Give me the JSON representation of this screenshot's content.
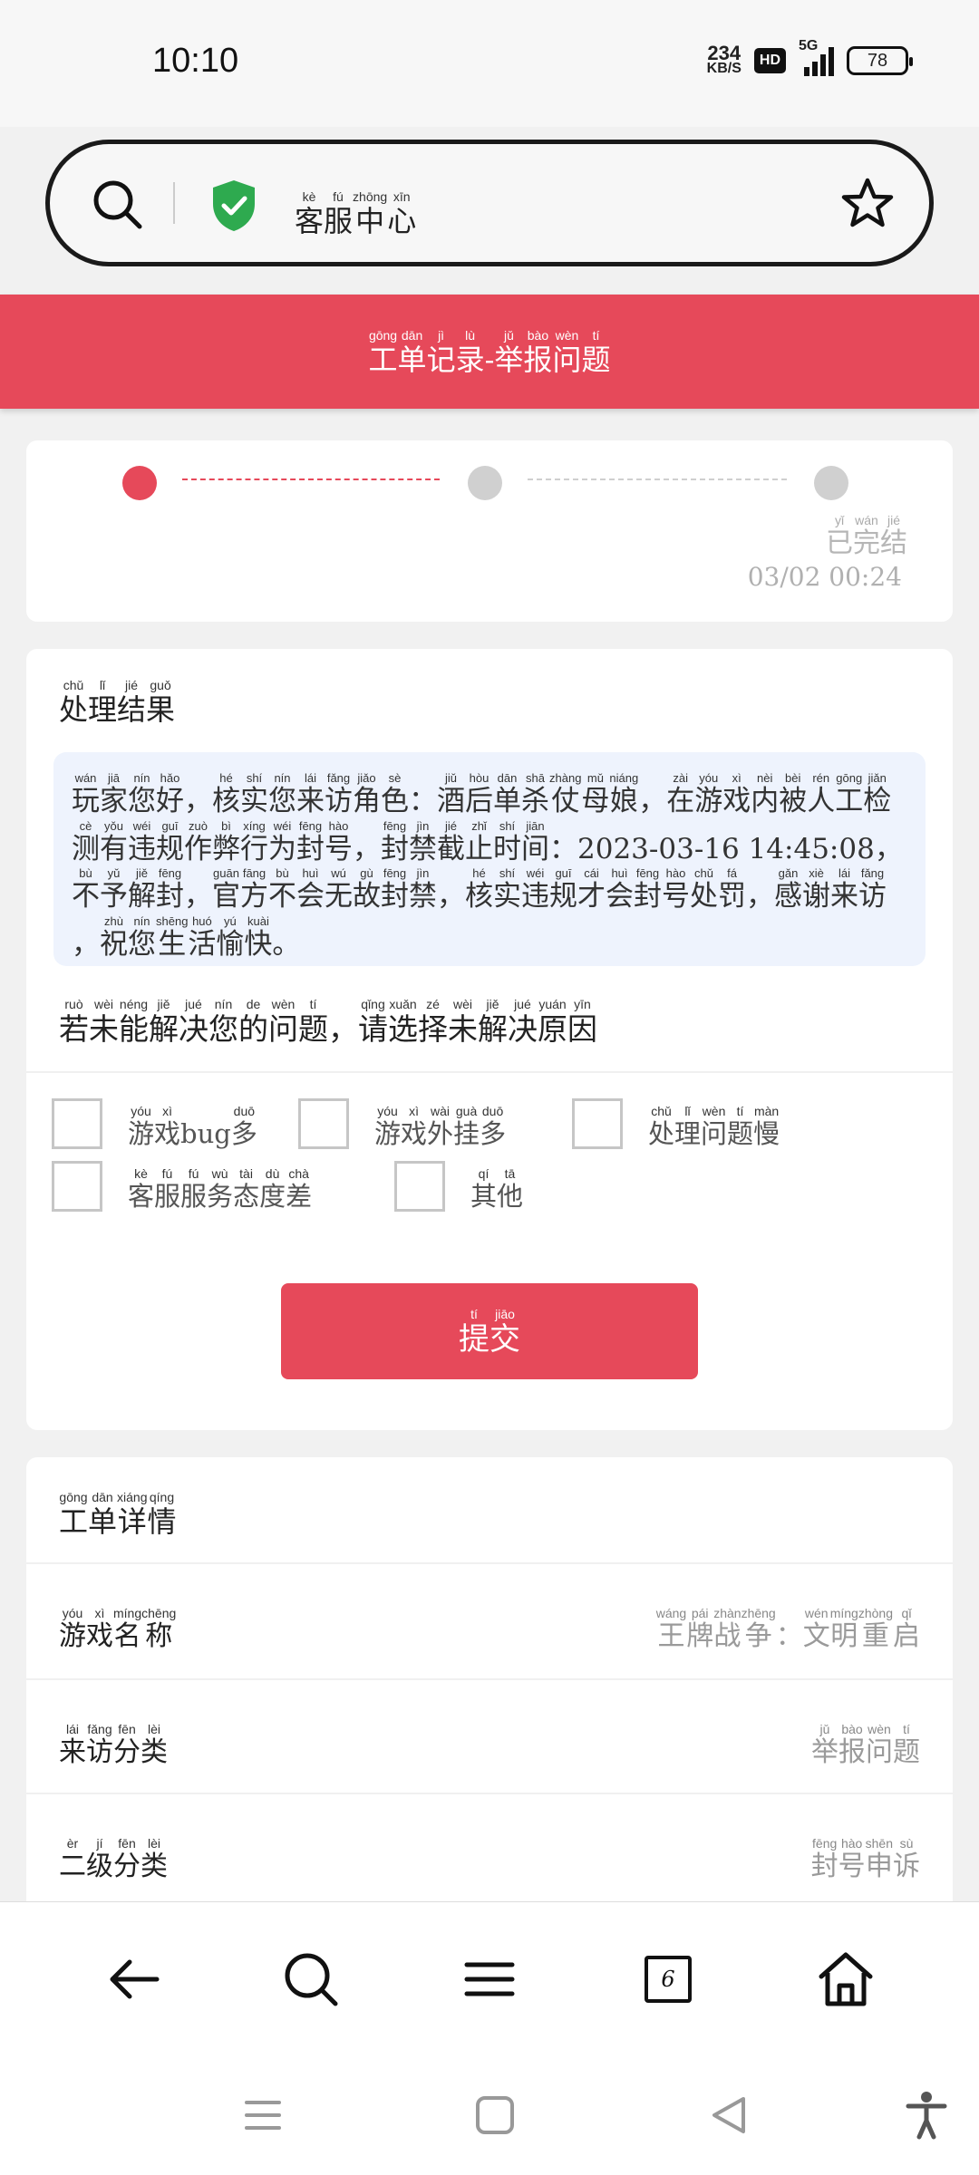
{
  "status_bar": {
    "time": "10:10",
    "net_speed": "234",
    "net_unit": "KB/S",
    "hd": "HD",
    "network": "5G",
    "battery": "78"
  },
  "search_bar": {
    "title": [
      [
        "kè",
        "客"
      ],
      [
        "fú",
        "服"
      ],
      [
        "zhōng",
        "中"
      ],
      [
        "xīn",
        "心"
      ]
    ]
  },
  "header": {
    "title": [
      [
        "gōng",
        "工"
      ],
      [
        "dān",
        "单"
      ],
      [
        "jì",
        "记"
      ],
      [
        "lù",
        "录"
      ],
      [
        "",
        "-"
      ],
      [
        "jǔ",
        "举"
      ],
      [
        "bào",
        "报"
      ],
      [
        "wèn",
        "问"
      ],
      [
        "tí",
        "题"
      ]
    ]
  },
  "progress": {
    "steps_done": 1,
    "steps_total": 3,
    "final_label": [
      [
        "yǐ",
        "已"
      ],
      [
        "wán",
        "完"
      ],
      [
        "jié",
        "结"
      ]
    ],
    "final_date": "03/02 00:24",
    "colors": {
      "active": "#e6495a",
      "inactive": "#d0d0d0"
    }
  },
  "result": {
    "title": [
      [
        "chǔ",
        "处"
      ],
      [
        "lǐ",
        "理"
      ],
      [
        "jié",
        "结"
      ],
      [
        "guǒ",
        "果"
      ]
    ],
    "text": [
      [
        "wán",
        "玩"
      ],
      [
        "jiā",
        "家"
      ],
      [
        "nín",
        "您"
      ],
      [
        "hǎo",
        "好"
      ],
      [
        "",
        "，"
      ],
      [
        "hé",
        "核"
      ],
      [
        "shí",
        "实"
      ],
      [
        "nín",
        "您"
      ],
      [
        "lái",
        "来"
      ],
      [
        "fǎng",
        "访"
      ],
      [
        "jiǎo",
        "角"
      ],
      [
        "sè",
        "色"
      ],
      [
        "",
        "："
      ],
      [
        "jiǔ",
        "酒"
      ],
      [
        "hòu",
        "后"
      ],
      [
        "dān",
        "单"
      ],
      [
        "shā",
        "杀"
      ],
      [
        "zhàng",
        "仗"
      ],
      [
        "mǔ",
        "母"
      ],
      [
        "niáng",
        "娘"
      ],
      [
        "",
        "，"
      ],
      [
        "zài",
        "在"
      ],
      [
        "yóu",
        "游"
      ],
      [
        "xì",
        "戏"
      ],
      [
        "nèi",
        "内"
      ],
      [
        "bèi",
        "被"
      ],
      [
        "rén",
        "人"
      ],
      [
        "gōng",
        "工"
      ],
      [
        "jiǎn",
        "检"
      ],
      [
        "cè",
        "测"
      ],
      [
        "yǒu",
        "有"
      ],
      [
        "wéi",
        "违"
      ],
      [
        "guī",
        "规"
      ],
      [
        "zuò",
        "作"
      ],
      [
        "bì",
        "弊"
      ],
      [
        "xíng",
        "行"
      ],
      [
        "wéi",
        "为"
      ],
      [
        "fēng",
        "封"
      ],
      [
        "hào",
        "号"
      ],
      [
        "",
        "，"
      ],
      [
        "fēng",
        "封"
      ],
      [
        "jìn",
        "禁"
      ],
      [
        "jié",
        "截"
      ],
      [
        "zhǐ",
        "止"
      ],
      [
        "shí",
        "时"
      ],
      [
        "jiān",
        "间"
      ],
      [
        "",
        "："
      ],
      [
        "",
        "2023-03-16 14:45:08"
      ],
      [
        "",
        "，"
      ],
      [
        "bù",
        "不"
      ],
      [
        "yǔ",
        "予"
      ],
      [
        "jiě",
        "解"
      ],
      [
        "fēng",
        "封"
      ],
      [
        "",
        "，"
      ],
      [
        "guān",
        "官"
      ],
      [
        "fāng",
        "方"
      ],
      [
        "bù",
        "不"
      ],
      [
        "huì",
        "会"
      ],
      [
        "wú",
        "无"
      ],
      [
        "gù",
        "故"
      ],
      [
        "fēng",
        "封"
      ],
      [
        "jìn",
        "禁"
      ],
      [
        "",
        "，"
      ],
      [
        "hé",
        "核"
      ],
      [
        "shí",
        "实"
      ],
      [
        "wéi",
        "违"
      ],
      [
        "guī",
        "规"
      ],
      [
        "cái",
        "才"
      ],
      [
        "huì",
        "会"
      ],
      [
        "fēng",
        "封"
      ],
      [
        "hào",
        "号"
      ],
      [
        "chǔ",
        "处"
      ],
      [
        "fá",
        "罚"
      ],
      [
        "",
        "，"
      ],
      [
        "gǎn",
        "感"
      ],
      [
        "xiè",
        "谢"
      ],
      [
        "lái",
        "来"
      ],
      [
        "fǎng",
        "访"
      ],
      [
        "",
        "，"
      ],
      [
        "zhù",
        "祝"
      ],
      [
        "nín",
        "您"
      ],
      [
        "shēng",
        "生"
      ],
      [
        "huó",
        "活"
      ],
      [
        "yú",
        "愉"
      ],
      [
        "kuài",
        "快"
      ],
      [
        "",
        "。"
      ]
    ],
    "question": [
      [
        "ruò",
        "若"
      ],
      [
        "wèi",
        "未"
      ],
      [
        "néng",
        "能"
      ],
      [
        "jiě",
        "解"
      ],
      [
        "jué",
        "决"
      ],
      [
        "nín",
        "您"
      ],
      [
        "de",
        "的"
      ],
      [
        "wèn",
        "问"
      ],
      [
        "tí",
        "题"
      ],
      [
        "",
        "，"
      ],
      [
        "qǐng",
        "请"
      ],
      [
        "xuǎn",
        "选"
      ],
      [
        "zé",
        "择"
      ],
      [
        "wèi",
        "未"
      ],
      [
        "jiě",
        "解"
      ],
      [
        "jué",
        "决"
      ],
      [
        "yuán",
        "原"
      ],
      [
        "yīn",
        "因"
      ]
    ],
    "options": [
      [
        [
          "yóu",
          "游"
        ],
        [
          "xì",
          "戏"
        ],
        [
          "",
          "bug"
        ],
        [
          "duō",
          "多"
        ]
      ],
      [
        [
          "yóu",
          "游"
        ],
        [
          "xì",
          "戏"
        ],
        [
          "wài",
          "外"
        ],
        [
          "guà",
          "挂"
        ],
        [
          "duō",
          "多"
        ]
      ],
      [
        [
          "chǔ",
          "处"
        ],
        [
          "lǐ",
          "理"
        ],
        [
          "wèn",
          "问"
        ],
        [
          "tí",
          "题"
        ],
        [
          "màn",
          "慢"
        ]
      ],
      [
        [
          "kè",
          "客"
        ],
        [
          "fú",
          "服"
        ],
        [
          "fú",
          "服"
        ],
        [
          "wù",
          "务"
        ],
        [
          "tài",
          "态"
        ],
        [
          "dù",
          "度"
        ],
        [
          "chà",
          "差"
        ]
      ],
      [
        [
          "qí",
          "其"
        ],
        [
          "tā",
          "他"
        ]
      ]
    ],
    "submit": [
      [
        "tí",
        "提"
      ],
      [
        "jiāo",
        "交"
      ]
    ]
  },
  "details": {
    "title": [
      [
        "gōng",
        "工"
      ],
      [
        "dān",
        "单"
      ],
      [
        "xiáng",
        "详"
      ],
      [
        "qíng",
        "情"
      ]
    ],
    "rows": [
      {
        "key": [
          [
            "yóu",
            "游"
          ],
          [
            "xì",
            "戏"
          ],
          [
            "míng",
            "名"
          ],
          [
            "chēng",
            "称"
          ]
        ],
        "value": [
          [
            "wáng",
            "王"
          ],
          [
            "pái",
            "牌"
          ],
          [
            "zhàn",
            "战"
          ],
          [
            "zhēng",
            "争"
          ],
          [
            "",
            "："
          ],
          [
            "wén",
            "文"
          ],
          [
            "míng",
            "明"
          ],
          [
            "zhòng",
            "重"
          ],
          [
            "qǐ",
            "启"
          ]
        ]
      },
      {
        "key": [
          [
            "lái",
            "来"
          ],
          [
            "fǎng",
            "访"
          ],
          [
            "fēn",
            "分"
          ],
          [
            "lèi",
            "类"
          ]
        ],
        "value": [
          [
            "jǔ",
            "举"
          ],
          [
            "bào",
            "报"
          ],
          [
            "wèn",
            "问"
          ],
          [
            "tí",
            "题"
          ]
        ]
      },
      {
        "key": [
          [
            "èr",
            "二"
          ],
          [
            "jí",
            "级"
          ],
          [
            "fēn",
            "分"
          ],
          [
            "lèi",
            "类"
          ]
        ],
        "value": [
          [
            "fēng",
            "封"
          ],
          [
            "hào",
            "号"
          ],
          [
            "shēn",
            "申"
          ],
          [
            "sù",
            "诉"
          ]
        ]
      }
    ]
  },
  "bottom_nav": {
    "tab_count": "6",
    "icons": [
      "back-arrow-icon",
      "search-icon",
      "menu-icon",
      "tabs-icon",
      "home-icon"
    ]
  },
  "system_nav": {
    "icons": [
      "recents-icon",
      "home-square-icon",
      "back-triangle-icon",
      "accessibility-icon"
    ]
  }
}
